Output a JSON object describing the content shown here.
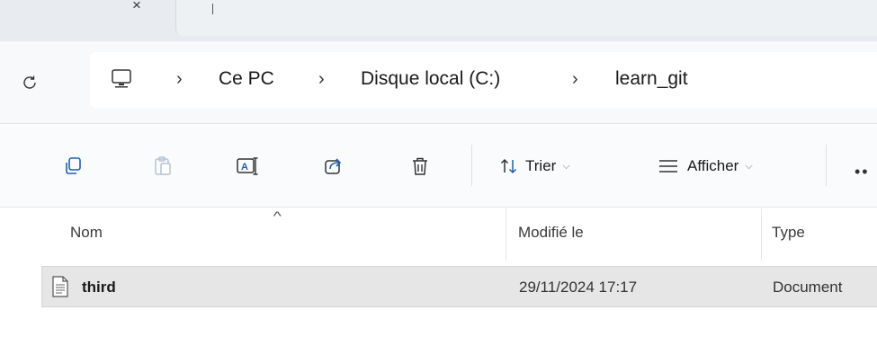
{
  "tabs": {
    "close_glyph": "×",
    "new_tab_glyph": "+"
  },
  "address": {
    "crumbs": [
      "Ce PC",
      "Disque local (C:)",
      "learn_git"
    ],
    "separator": "›"
  },
  "commands": {
    "icons": [
      "copy-icon",
      "paste-icon",
      "rename-icon",
      "share-icon",
      "delete-icon"
    ],
    "sort_label": "Trier",
    "view_label": "Afficher",
    "more_label": "••"
  },
  "columns": {
    "name": "Nom",
    "modified": "Modifié le",
    "type": "Type"
  },
  "files": [
    {
      "name": "third",
      "modified": "29/11/2024 17:17",
      "type": "Document"
    }
  ],
  "colors": {
    "selection": "#e6e6e6",
    "accent": "#005fb8"
  }
}
